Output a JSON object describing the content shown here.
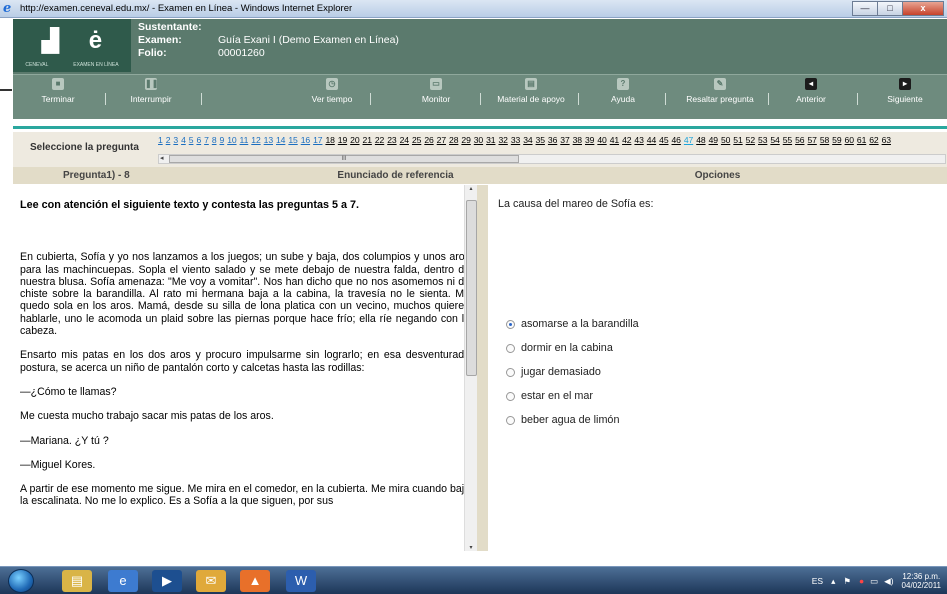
{
  "window": {
    "title": "http://examen.ceneval.edu.mx/ - Examen en Línea - Windows Internet Explorer",
    "controls": {
      "minimize": "—",
      "maximize": "□",
      "close": "x"
    }
  },
  "brand": {
    "logo_left": "CENEVAL",
    "logo_right": "EXAMEN EN LÍNEA"
  },
  "info": {
    "sustentante_label": "Sustentante:",
    "sustentante_value": "",
    "examen_label": "Examen:",
    "examen_value": "Guía Exani I (Demo Examen en Línea)",
    "folio_label": "Folio:",
    "folio_value": "00001260"
  },
  "toolbar": {
    "terminar": "Terminar",
    "interrumpir": "Interrumpir",
    "ver_tiempo": "Ver tiempo",
    "monitor": "Monitor",
    "material": "Material de apoyo",
    "ayuda": "Ayuda",
    "resaltar": "Resaltar pregunta",
    "anterior": "Anterior",
    "siguiente": "Siguiente"
  },
  "selector": {
    "label": "Seleccione la pregunta",
    "numbers": [
      "1",
      "2",
      "3",
      "4",
      "5",
      "6",
      "7",
      "8",
      "9",
      "10",
      "11",
      "12",
      "13",
      "14",
      "15",
      "16",
      "17",
      "18",
      "19",
      "20",
      "21",
      "22",
      "23",
      "24",
      "25",
      "26",
      "27",
      "28",
      "29",
      "30",
      "31",
      "32",
      "33",
      "34",
      "35",
      "36",
      "37",
      "38",
      "39",
      "40",
      "41",
      "42",
      "43",
      "44",
      "45",
      "46",
      "47",
      "48",
      "49",
      "50",
      "51",
      "52",
      "53",
      "54",
      "55",
      "56",
      "57",
      "58",
      "59",
      "60",
      "61",
      "62",
      "63"
    ],
    "scroll_thumb": "III"
  },
  "columns": {
    "pregunta": "Pregunta1) - 8",
    "enunciado": "Enunciado de referencia",
    "opciones": "Opciones"
  },
  "reading": {
    "heading": "Lee con atención el siguiente texto y contesta las preguntas  5 a 7.",
    "p1": "En cubierta, Sofía y yo nos lanzamos a los juegos; un sube y baja, dos columpios y unos aros para las machincuepas. Sopla el viento salado y se mete debajo de nuestra falda, dentro de nuestra blusa. Sofía amenaza: \"Me voy a vomitar\". Nos han dicho que no nos asomemos ni de chiste sobre la barandilla. Al rato mi hermana baja a la cabina, la travesía no le sienta. Me quedo sola en los aros. Mamá, desde su silla de lona platica con un vecino, muchos quieren hablarle, uno le acomoda un plaid sobre las piernas porque hace frío; ella ríe negando con la cabeza.",
    "p2": "Ensarto mis patas en los dos aros y procuro impulsarme sin lograrlo; en esa desventurada postura, se acerca un niño de pantalón corto y calcetas hasta las rodillas:",
    "p3": "—¿Cómo te llamas?",
    "p4": "Me cuesta mucho trabajo sacar mis patas de los aros.",
    "p5": "—Mariana. ¿Y tú ?",
    "p6": "—Miguel Kores.",
    "p7": "A partir de ese momento me sigue. Me mira en el comedor, en la cubierta. Me mira cuando bajo la escalinata. No me lo explico. Es a Sofía a la que siguen, por sus"
  },
  "question": {
    "text": "La causa del mareo de Sofía es:",
    "options": [
      {
        "label": "asomarse a la barandilla",
        "selected": true
      },
      {
        "label": "dormir en la cabina",
        "selected": false
      },
      {
        "label": "jugar demasiado",
        "selected": false
      },
      {
        "label": "estar en el mar",
        "selected": false
      },
      {
        "label": "beber agua de limón",
        "selected": false
      }
    ]
  },
  "taskbar": {
    "lang": "ES",
    "time": "12:36 p.m.",
    "date": "04/02/2011"
  }
}
